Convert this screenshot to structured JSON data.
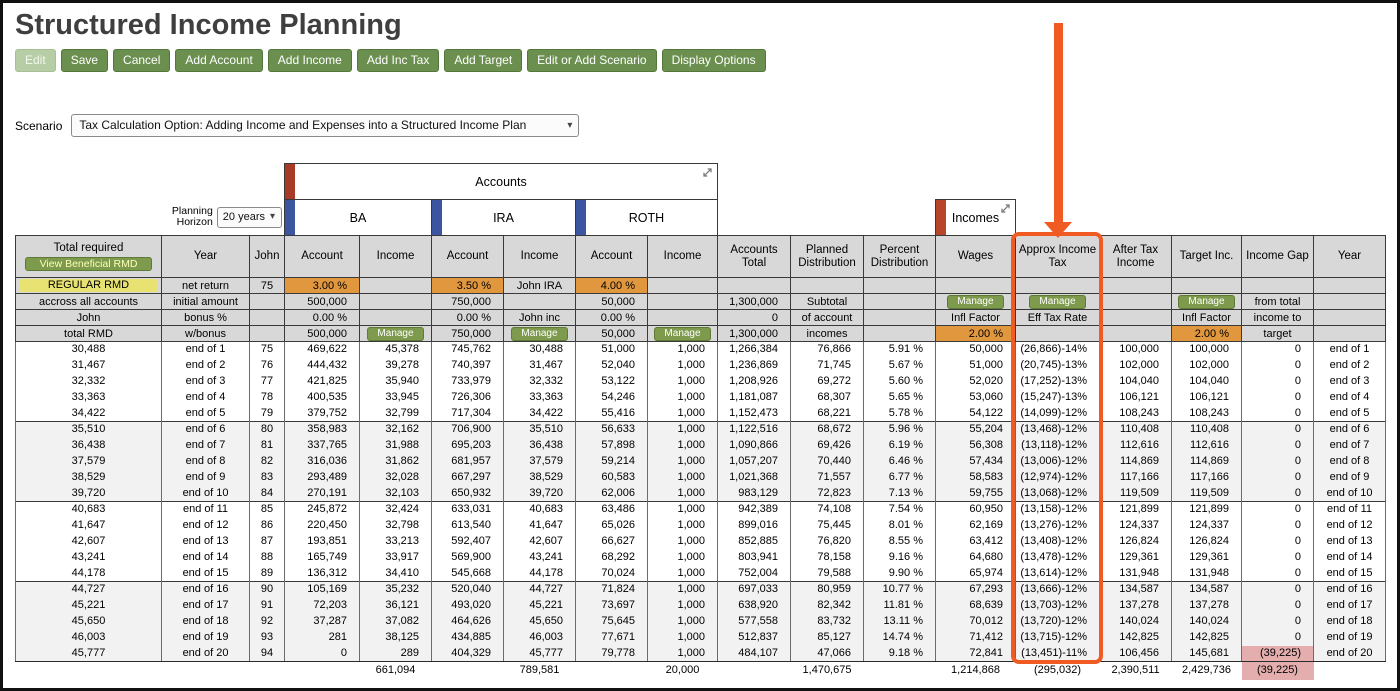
{
  "title": "Structured Income Planning",
  "toolbar": {
    "edit": "Edit",
    "save": "Save",
    "cancel": "Cancel",
    "add_account": "Add Account",
    "add_income": "Add Income",
    "add_inc_tax": "Add Inc Tax",
    "add_target": "Add Target",
    "edit_or_add_scenario": "Edit or Add Scenario",
    "display_options": "Display Options"
  },
  "scenario": {
    "label": "Scenario",
    "selected": "Tax Calculation Option: Adding Income and Expenses into a Structured Income Plan"
  },
  "planning_horizon": {
    "label_lines": [
      "Planning",
      "Horizon"
    ],
    "selected": "20 years"
  },
  "groups": {
    "accounts": "Accounts",
    "incomes": "Incomes",
    "ba": "BA",
    "ira": "IRA",
    "roth": "ROTH"
  },
  "view_beneficial_rmd": "View Beneficial RMD",
  "columns": [
    "Total required",
    "Year",
    "John",
    "Account",
    "Income",
    "Account",
    "Income",
    "Account",
    "Income",
    "Accounts Total",
    "Planned Distribution",
    "Percent Distribution",
    "Wages",
    "Approx Income Tax",
    "After Tax Income",
    "Target Inc.",
    "Income Gap",
    "Year"
  ],
  "subheader": [
    [
      {
        "t": "REGULAR RMD",
        "type": "yellow"
      },
      "net return",
      "75",
      {
        "t": "3.00 %",
        "type": "orange"
      },
      "",
      {
        "t": "3.50 %",
        "type": "orange"
      },
      "John IRA",
      {
        "t": "4.00 %",
        "type": "orange"
      },
      "",
      "",
      "",
      "",
      "",
      "",
      "",
      "",
      "",
      ""
    ],
    [
      "accross all accounts",
      "initial amount",
      "",
      "500,000",
      "",
      "750,000",
      "",
      "50,000",
      "",
      "1,300,000",
      "Subtotal",
      "",
      {
        "t": "Manage",
        "type": "btn"
      },
      {
        "t": "Manage",
        "type": "btn"
      },
      "",
      {
        "t": "Manage",
        "type": "btn"
      },
      "from total",
      ""
    ],
    [
      "John",
      "bonus %",
      "",
      "0.00 %",
      "",
      "0.00 %",
      "John inc",
      "0.00 %",
      "",
      "0",
      "of account",
      "",
      "Infl Factor",
      "Eff Tax Rate",
      "",
      "Infl Factor",
      "income to",
      ""
    ],
    [
      "total RMD",
      "w/bonus",
      "",
      "500,000",
      {
        "t": "Manage",
        "type": "btn"
      },
      "750,000",
      {
        "t": "Manage",
        "type": "btn"
      },
      "50,000",
      {
        "t": "Manage",
        "type": "btn"
      },
      "1,300,000",
      "incomes",
      "",
      {
        "t": "2.00 %",
        "type": "orange"
      },
      "",
      "",
      {
        "t": "2.00 %",
        "type": "orange"
      },
      "target",
      ""
    ]
  ],
  "rows": [
    [
      "30,488",
      "end of 1",
      "75",
      "469,622",
      "45,378",
      "745,762",
      "30,488",
      "51,000",
      "1,000",
      "1,266,384",
      "76,866",
      "5.91 %",
      "50,000",
      "(26,866)-14%",
      "100,000",
      "100,000",
      "0",
      "end of 1"
    ],
    [
      "31,467",
      "end of 2",
      "76",
      "444,432",
      "39,278",
      "740,397",
      "31,467",
      "52,040",
      "1,000",
      "1,236,869",
      "71,745",
      "5.67 %",
      "51,000",
      "(20,745)-13%",
      "102,000",
      "102,000",
      "0",
      "end of 2"
    ],
    [
      "32,332",
      "end of 3",
      "77",
      "421,825",
      "35,940",
      "733,979",
      "32,332",
      "53,122",
      "1,000",
      "1,208,926",
      "69,272",
      "5.60 %",
      "52,020",
      "(17,252)-13%",
      "104,040",
      "104,040",
      "0",
      "end of 3"
    ],
    [
      "33,363",
      "end of 4",
      "78",
      "400,535",
      "33,945",
      "726,306",
      "33,363",
      "54,246",
      "1,000",
      "1,181,087",
      "68,307",
      "5.65 %",
      "53,060",
      "(15,247)-13%",
      "106,121",
      "106,121",
      "0",
      "end of 4"
    ],
    [
      "34,422",
      "end of 5",
      "79",
      "379,752",
      "32,799",
      "717,304",
      "34,422",
      "55,416",
      "1,000",
      "1,152,473",
      "68,221",
      "5.78 %",
      "54,122",
      "(14,099)-12%",
      "108,243",
      "108,243",
      "0",
      "end of 5"
    ],
    [
      "35,510",
      "end of 6",
      "80",
      "358,983",
      "32,162",
      "706,900",
      "35,510",
      "56,633",
      "1,000",
      "1,122,516",
      "68,672",
      "5.96 %",
      "55,204",
      "(13,468)-12%",
      "110,408",
      "110,408",
      "0",
      "end of 6"
    ],
    [
      "36,438",
      "end of 7",
      "81",
      "337,765",
      "31,988",
      "695,203",
      "36,438",
      "57,898",
      "1,000",
      "1,090,866",
      "69,426",
      "6.19 %",
      "56,308",
      "(13,118)-12%",
      "112,616",
      "112,616",
      "0",
      "end of 7"
    ],
    [
      "37,579",
      "end of 8",
      "82",
      "316,036",
      "31,862",
      "681,957",
      "37,579",
      "59,214",
      "1,000",
      "1,057,207",
      "70,440",
      "6.46 %",
      "57,434",
      "(13,006)-12%",
      "114,869",
      "114,869",
      "0",
      "end of 8"
    ],
    [
      "38,529",
      "end of 9",
      "83",
      "293,489",
      "32,028",
      "667,297",
      "38,529",
      "60,583",
      "1,000",
      "1,021,368",
      "71,557",
      "6.77 %",
      "58,583",
      "(12,974)-12%",
      "117,166",
      "117,166",
      "0",
      "end of 9"
    ],
    [
      "39,720",
      "end of 10",
      "84",
      "270,191",
      "32,103",
      "650,932",
      "39,720",
      "62,006",
      "1,000",
      "983,129",
      "72,823",
      "7.13 %",
      "59,755",
      "(13,068)-12%",
      "119,509",
      "119,509",
      "0",
      "end of 10"
    ],
    [
      "40,683",
      "end of 11",
      "85",
      "245,872",
      "32,424",
      "633,031",
      "40,683",
      "63,486",
      "1,000",
      "942,389",
      "74,108",
      "7.54 %",
      "60,950",
      "(13,158)-12%",
      "121,899",
      "121,899",
      "0",
      "end of 11"
    ],
    [
      "41,647",
      "end of 12",
      "86",
      "220,450",
      "32,798",
      "613,540",
      "41,647",
      "65,026",
      "1,000",
      "899,016",
      "75,445",
      "8.01 %",
      "62,169",
      "(13,276)-12%",
      "124,337",
      "124,337",
      "0",
      "end of 12"
    ],
    [
      "42,607",
      "end of 13",
      "87",
      "193,851",
      "33,213",
      "592,407",
      "42,607",
      "66,627",
      "1,000",
      "852,885",
      "76,820",
      "8.55 %",
      "63,412",
      "(13,408)-12%",
      "126,824",
      "126,824",
      "0",
      "end of 13"
    ],
    [
      "43,241",
      "end of 14",
      "88",
      "165,749",
      "33,917",
      "569,900",
      "43,241",
      "68,292",
      "1,000",
      "803,941",
      "78,158",
      "9.16 %",
      "64,680",
      "(13,478)-12%",
      "129,361",
      "129,361",
      "0",
      "end of 14"
    ],
    [
      "44,178",
      "end of 15",
      "89",
      "136,312",
      "34,410",
      "545,668",
      "44,178",
      "70,024",
      "1,000",
      "752,004",
      "79,588",
      "9.90 %",
      "65,974",
      "(13,614)-12%",
      "131,948",
      "131,948",
      "0",
      "end of 15"
    ],
    [
      "44,727",
      "end of 16",
      "90",
      "105,169",
      "35,232",
      "520,040",
      "44,727",
      "71,824",
      "1,000",
      "697,033",
      "80,959",
      "10.77 %",
      "67,293",
      "(13,666)-12%",
      "134,587",
      "134,587",
      "0",
      "end of 16"
    ],
    [
      "45,221",
      "end of 17",
      "91",
      "72,203",
      "36,121",
      "493,020",
      "45,221",
      "73,697",
      "1,000",
      "638,920",
      "82,342",
      "11.81 %",
      "68,639",
      "(13,703)-12%",
      "137,278",
      "137,278",
      "0",
      "end of 17"
    ],
    [
      "45,650",
      "end of 18",
      "92",
      "37,287",
      "37,082",
      "464,626",
      "45,650",
      "75,645",
      "1,000",
      "577,558",
      "83,732",
      "13.11 %",
      "70,012",
      "(13,720)-12%",
      "140,024",
      "140,024",
      "0",
      "end of 18"
    ],
    [
      "46,003",
      "end of 19",
      "93",
      "281",
      "38,125",
      "434,885",
      "46,003",
      "77,671",
      "1,000",
      "512,837",
      "85,127",
      "14.74 %",
      "71,412",
      "(13,715)-12%",
      "142,825",
      "142,825",
      "0",
      "end of 19"
    ],
    [
      "45,777",
      "end of 20",
      "94",
      "0",
      "289",
      "404,329",
      "45,777",
      "79,778",
      "1,000",
      "484,107",
      "47,066",
      "9.18 %",
      "72,841",
      "(13,451)-11%",
      "106,456",
      "145,681",
      "(39,225)",
      "end of 20"
    ]
  ],
  "totals": [
    "",
    "",
    "",
    "",
    "661,094",
    "",
    "789,581",
    "",
    "20,000",
    "",
    "1,470,675",
    "",
    "1,214,868",
    "(295,032)",
    "2,390,511",
    "2,429,736",
    "(39,225)",
    ""
  ],
  "colors": {
    "highlight": "#ef5b22",
    "accounts_bar": "#a83a28",
    "account_bar": "#3b55a0",
    "incomes_bar": "#b7452c",
    "orange_cell": "#e0973e",
    "pink_cell": "#e4aeae",
    "button_green": "#6b8f4e",
    "manage_green": "#7d9a4d",
    "rmd_yellow": "#e8e272"
  }
}
